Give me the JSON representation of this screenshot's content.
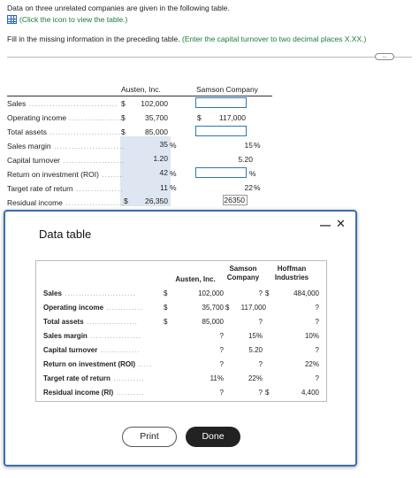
{
  "intro": "Data on three unrelated companies are given in the following table.",
  "click_link": "(Click the icon to view the table.)",
  "instructions": {
    "main": "Fill in the missing information in the preceding table.",
    "hint": "(Enter the capital turnover to two decimal places X.XX.)"
  },
  "more_label": "...",
  "main_table": {
    "headers": {
      "austen": "Austen, Inc.",
      "samson": "Samson Company"
    },
    "rows": [
      {
        "label": "Sales",
        "austen_sym": "$",
        "austen": "102,000",
        "samson_sym": "",
        "samson": "",
        "samson_pct": ""
      },
      {
        "label": "Operating income",
        "austen_sym": "$",
        "austen": "35,700",
        "samson_sym": "$",
        "samson": "117,000",
        "samson_pct": ""
      },
      {
        "label": "Total assets",
        "austen_sym": "$",
        "austen": "85,000",
        "samson_sym": "",
        "samson": "",
        "samson_pct": ""
      },
      {
        "label": "Sales margin",
        "austen_sym": "",
        "austen": "35",
        "austen_pct": "%",
        "samson": "15",
        "samson_pct": "%"
      },
      {
        "label": "Capital turnover",
        "austen_sym": "",
        "austen": "1.20",
        "austen_pct": "",
        "samson": "5.20",
        "samson_pct": ""
      },
      {
        "label": "Return on investment (ROI)",
        "austen_sym": "",
        "austen": "42",
        "austen_pct": "%",
        "samson": "",
        "samson_pct": "%"
      },
      {
        "label": "Target rate of return",
        "austen_sym": "",
        "austen": "11",
        "austen_pct": "%",
        "samson": "22",
        "samson_pct": "%"
      },
      {
        "label": "Residual income",
        "austen_sym": "$",
        "austen": "26,350",
        "austen_pct": "",
        "samson": "26350",
        "samson_pct": ""
      }
    ]
  },
  "data_table": {
    "title": "Data table",
    "headers": {
      "austen": "Austen, Inc.",
      "samson": "Samson Company",
      "hoffman": "Hoffman Industries"
    },
    "rows": [
      {
        "label": "Sales",
        "sym": "$",
        "austen": "102,000",
        "samson": "?",
        "samson_sym": "$",
        "hoffman": "484,000"
      },
      {
        "label": "Operating income",
        "sym": "$",
        "austen": "35,700",
        "austen_sym2": "$",
        "samson": "117,000",
        "hoffman": "?"
      },
      {
        "label": "Total assets",
        "sym": "$",
        "austen": "85,000",
        "samson": "?",
        "hoffman": "?"
      },
      {
        "label": "Sales margin",
        "austen": "?",
        "samson": "15%",
        "hoffman": "10%"
      },
      {
        "label": "Capital turnover",
        "austen": "?",
        "samson": "5.20",
        "hoffman": "?"
      },
      {
        "label": "Return on investment (ROI)",
        "austen": "?",
        "samson": "?",
        "hoffman": "22%"
      },
      {
        "label": "Target rate of return",
        "austen": "11%",
        "samson": "22%",
        "hoffman": "?"
      },
      {
        "label": "Residual income (RI)",
        "austen": "?",
        "samson": "?",
        "samson_sym": "$",
        "hoffman": "4,400"
      }
    ],
    "buttons": {
      "print": "Print",
      "done": "Done"
    },
    "minimize": "—",
    "close": "✕"
  }
}
